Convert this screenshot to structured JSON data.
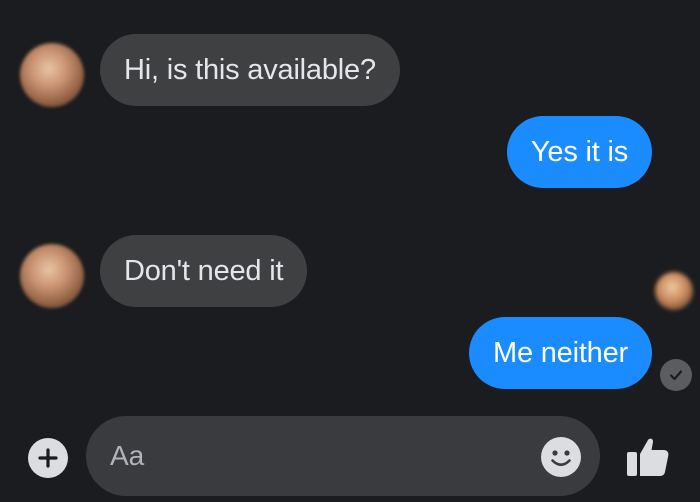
{
  "messages": [
    {
      "id": "m1",
      "direction": "incoming",
      "text": "Hi, is this available?"
    },
    {
      "id": "m2",
      "direction": "outgoing",
      "text": "Yes it is"
    },
    {
      "id": "m3",
      "direction": "incoming",
      "text": "Don't need it"
    },
    {
      "id": "m4",
      "direction": "outgoing",
      "text": "Me neither"
    }
  ],
  "composer": {
    "placeholder": "Aa",
    "add_icon": "plus-circle-icon",
    "emoji_icon": "smiley-icon",
    "like_icon": "thumbs-up-icon"
  },
  "status": {
    "delivered_icon": "check-circle-icon"
  },
  "colors": {
    "background": "#1b1c1f",
    "incoming_bubble": "#3e4042",
    "outgoing_bubble": "#1a8cff",
    "text_light": "#e4e6eb"
  }
}
